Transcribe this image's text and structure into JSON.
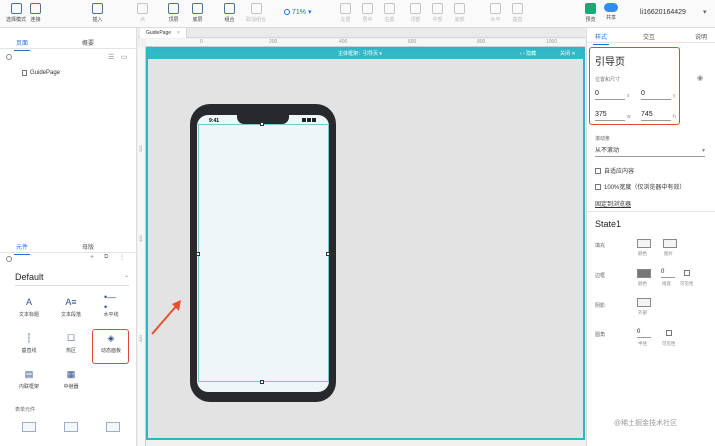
{
  "toolbar": {
    "tools": [
      {
        "label": "选择模式",
        "icon": "select-mode-icon"
      },
      {
        "label": "连接",
        "icon": "connect-icon"
      },
      {
        "label": "插入",
        "icon": "insert-icon"
      }
    ],
    "disabled_tools": [
      {
        "label": "点",
        "icon": "point-icon"
      },
      {
        "label": "顶层",
        "icon": "top-layer-icon"
      },
      {
        "label": "底层",
        "icon": "bottom-layer-icon"
      },
      {
        "label": "组合",
        "icon": "group-icon"
      },
      {
        "label": "取消组合",
        "icon": "ungroup-icon"
      },
      {
        "label": "左置",
        "icon": "align-left-icon"
      },
      {
        "label": "居中",
        "icon": "align-center-icon"
      },
      {
        "label": "右置",
        "icon": "align-right-icon"
      },
      {
        "label": "顶部",
        "icon": "align-top-icon"
      },
      {
        "label": "中部",
        "icon": "align-middle-icon"
      },
      {
        "label": "底部",
        "icon": "align-bottom-icon"
      },
      {
        "label": "水平",
        "icon": "distribute-h-icon"
      },
      {
        "label": "垂直",
        "icon": "distribute-v-icon"
      }
    ],
    "zoom": "71%",
    "preview_label": "预览",
    "share_label": "共享",
    "account": "li16620164429"
  },
  "left_panel": {
    "tabs": [
      "页面",
      "概要"
    ],
    "active_tab": "页面",
    "page_item": "GuidePage",
    "library_tabs": [
      "元件",
      "母版"
    ],
    "library_name": "Default",
    "widgets": [
      {
        "label": "文本标题",
        "glyph": "A"
      },
      {
        "label": "文本段落",
        "glyph": "A≡"
      },
      {
        "label": "水平线",
        "glyph": "•—•"
      },
      {
        "label": "垂直线",
        "glyph": "┆"
      },
      {
        "label": "热区",
        "glyph": "☐"
      },
      {
        "label": "动态面板",
        "glyph": "◈"
      },
      {
        "label": "内联框架",
        "glyph": "▤"
      },
      {
        "label": "中继器",
        "glyph": "▦"
      }
    ],
    "section_label": "表单元件"
  },
  "canvas": {
    "doc_tab": "GuidePage",
    "master_bar_label": "主体框架：引导页 ▾",
    "master_bar_right": "‹ ›  隐藏",
    "master_bar_close": "关闭 ✕",
    "ruler_ticks": [
      "0",
      "200",
      "400",
      "600",
      "800",
      "1000"
    ],
    "ruler_vticks": [
      "200",
      "400",
      "600"
    ],
    "phone_time": "9:41",
    "arrow_color": "#e8502f"
  },
  "right_panel": {
    "tabs": [
      "样式",
      "交互",
      "说明"
    ],
    "active_tab": "样式",
    "page_title": "引导页",
    "position_label": "位置和尺寸",
    "x_value": "0",
    "y_value": "0",
    "w_value": "375",
    "h_value": "745",
    "units": {
      "x": "x",
      "y": "y",
      "w": "w",
      "h": "h"
    },
    "scroll_label": "滚动条",
    "scroll_value": "从不滚动",
    "auto_fit": "自适应内容",
    "full_width": "100%宽度（仅浏览器中有效）",
    "link_text": "固定到浏览器",
    "state_title": "State1",
    "fill_label": "填充",
    "fill_options": [
      "颜色",
      "图片"
    ],
    "border_label": "边框",
    "border_options": [
      "颜色",
      "线宽",
      "可见性"
    ],
    "border_width": "0",
    "shadow_label": "阴影",
    "shadow_options": [
      "外部"
    ],
    "radius_label": "圆角",
    "radius_value": "0",
    "radius_options": [
      "半径",
      "可见性"
    ]
  },
  "watermark": "@稀土掘金技术社区",
  "colors": {
    "accent": "#1e6fd9",
    "master_bar": "#33b8c7",
    "highlight": "#e0483a"
  }
}
